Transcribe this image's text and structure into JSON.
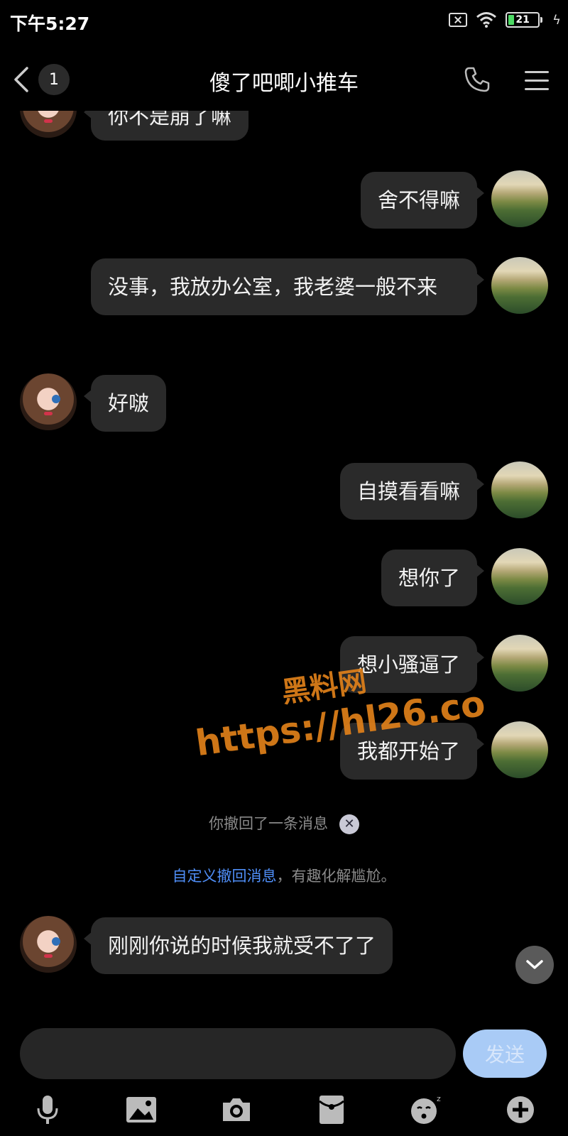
{
  "status_bar": {
    "time": "下午5:27",
    "battery": "21",
    "battery_level": 0.21
  },
  "header": {
    "unread_count": "1",
    "title": "傻了吧唧小推车"
  },
  "messages": [
    {
      "side": "left",
      "text": "你不是崩了嘛"
    },
    {
      "side": "right",
      "text": "舍不得嘛"
    },
    {
      "side": "right",
      "text": "没事，我放办公室，我老婆一般不来"
    },
    {
      "side": "left",
      "text": "好啵"
    },
    {
      "side": "right",
      "text": "自摸看看嘛"
    },
    {
      "side": "right",
      "text": "想你了"
    },
    {
      "side": "right",
      "text": "想小骚逼了"
    },
    {
      "side": "right",
      "text": "我都开始了"
    },
    {
      "side": "left",
      "text": "刚刚你说的时候我就受不了了"
    }
  ],
  "recall": {
    "notice": "你撤回了一条消息",
    "custom_link": "自定义撤回消息",
    "custom_rest": "，有趣化解尴尬。"
  },
  "watermark": {
    "line1": "黑料网",
    "line2": "https://hl26.co"
  },
  "input": {
    "send_label": "发送"
  },
  "toolbar": {
    "icons": [
      "microphone-icon",
      "image-icon",
      "camera-icon",
      "red-envelope-icon",
      "emoji-icon",
      "plus-icon"
    ]
  }
}
